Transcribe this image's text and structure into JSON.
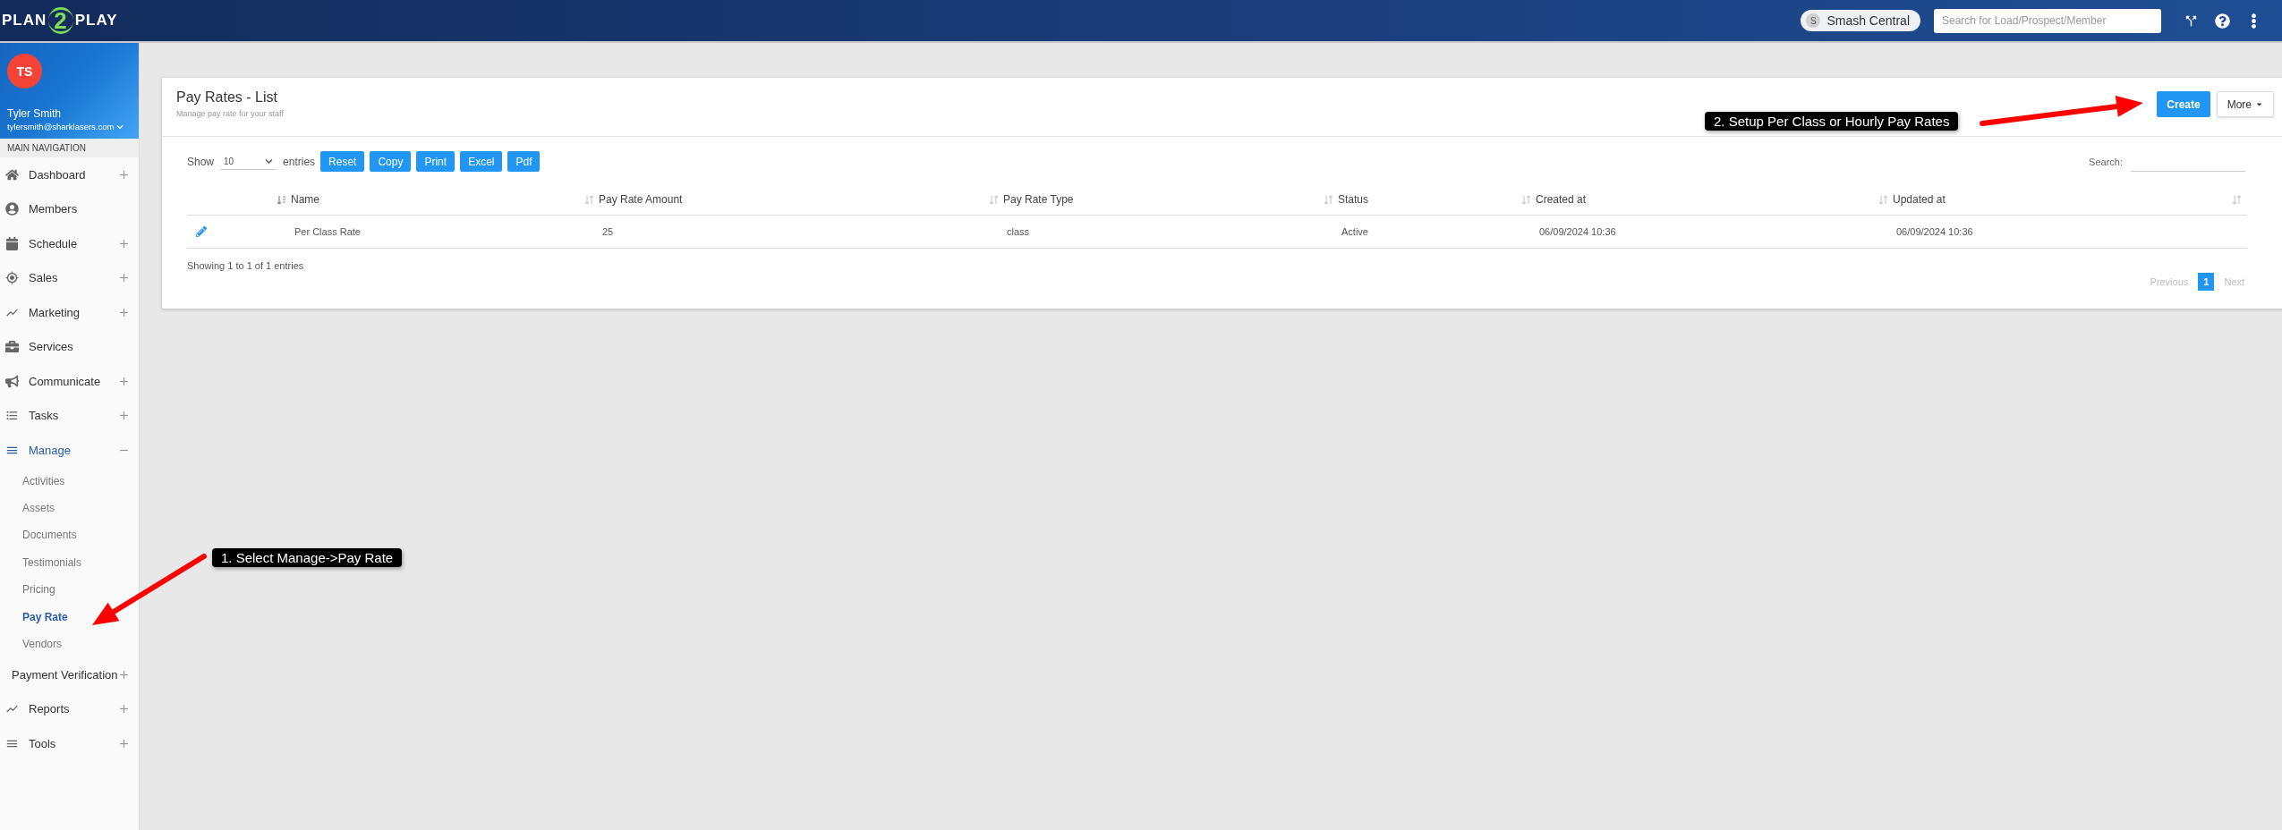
{
  "topbar": {
    "logo": {
      "left": "PLAN",
      "mark": "2",
      "right": "PLAY"
    },
    "location": {
      "initial": "S",
      "name": "Smash Central"
    },
    "search": {
      "placeholder": "Search for Load/Prospect/Member"
    }
  },
  "profile": {
    "initials": "TS",
    "name": "Tyler Smith",
    "email": "tylersmith@sharklasers.com"
  },
  "sidebar": {
    "heading": "MAIN NAVIGATION",
    "items": [
      {
        "label": "Dashboard",
        "selected": false,
        "expanded": false
      },
      {
        "label": "Members",
        "selected": false
      },
      {
        "label": "Schedule",
        "selected": false,
        "expanded": false
      },
      {
        "label": "Sales",
        "selected": false,
        "expanded": false
      },
      {
        "label": "Marketing",
        "selected": false,
        "expanded": false
      },
      {
        "label": "Services",
        "selected": false
      },
      {
        "label": "Communicate",
        "selected": false,
        "expanded": false
      },
      {
        "label": "Tasks",
        "selected": false,
        "expanded": false
      },
      {
        "label": "Manage",
        "selected": true,
        "expanded": true,
        "children": [
          {
            "label": "Activities",
            "selected": false
          },
          {
            "label": "Assets",
            "selected": false
          },
          {
            "label": "Documents",
            "selected": false
          },
          {
            "label": "Testimonials",
            "selected": false
          },
          {
            "label": "Pricing",
            "selected": false
          },
          {
            "label": "Pay Rate",
            "selected": true
          },
          {
            "label": "Vendors",
            "selected": false
          }
        ]
      },
      {
        "label": "Payment Verification",
        "selected": false,
        "expanded": false
      },
      {
        "label": "Reports",
        "selected": false,
        "expanded": false
      },
      {
        "label": "Tools",
        "selected": false,
        "expanded": false
      }
    ]
  },
  "card": {
    "title": "Pay Rates - List",
    "subtitle": "Manage pay rate for your staff",
    "actions": [
      {
        "label": "Create",
        "kind": "primary"
      },
      {
        "label": "More",
        "kind": "dropdown"
      }
    ],
    "length": {
      "before": "Show",
      "value": "10",
      "after": "entries"
    },
    "export_buttons": [
      "Reset",
      "Copy",
      "Print",
      "Excel",
      "Pdf"
    ],
    "search_label": "Search:",
    "table": {
      "columns": [
        {
          "label": "Name",
          "sorted": true
        },
        {
          "label": "Pay Rate Amount",
          "sorted": false
        },
        {
          "label": "Pay Rate Type",
          "sorted": false
        },
        {
          "label": "Status",
          "sorted": false
        },
        {
          "label": "Created at",
          "sorted": false
        },
        {
          "label": "Updated at",
          "sorted": false
        },
        {
          "sorted": false
        }
      ],
      "rows": [
        {
          "cells": [
            "Per Class Rate",
            "25",
            "class",
            "Active",
            "06/09/2024 10:36",
            "06/09/2024 10:36"
          ]
        }
      ]
    },
    "info": "Showing 1 to 1 of 1 entries",
    "pagination": [
      {
        "label": "Previous",
        "kind": "link",
        "disabled": true
      },
      {
        "label": "1",
        "kind": "page",
        "selected": true
      },
      {
        "label": "Next",
        "kind": "link",
        "disabled": true
      }
    ]
  },
  "annotations": [
    "1. Select Manage->Pay Rate",
    "2. Setup Per Class or Hourly Pay Rates"
  ]
}
